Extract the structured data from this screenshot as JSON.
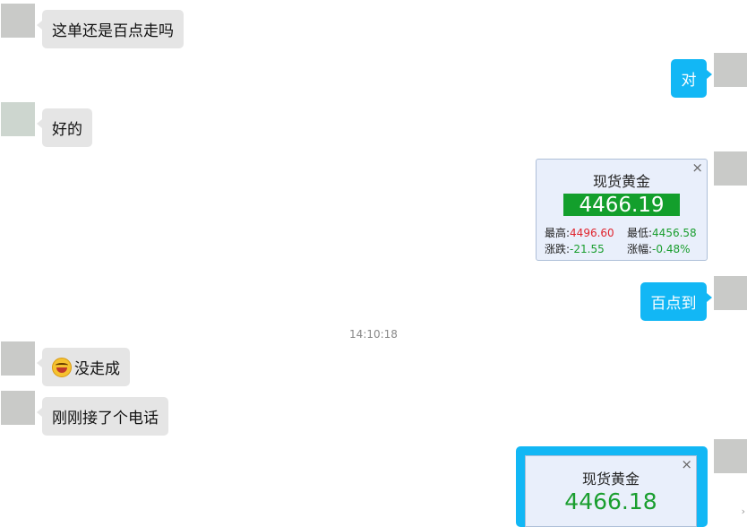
{
  "messages": {
    "m1": {
      "text": "这单还是百点走吗"
    },
    "m2": {
      "text": "对"
    },
    "m3": {
      "text": "好的"
    },
    "m5": {
      "text": "百点到"
    },
    "timestamp": "14:10:18",
    "m6": {
      "text": "没走成",
      "emoji_icon": "laughing-face-icon"
    },
    "m7": {
      "text": "刚刚接了个电话"
    }
  },
  "quote_card": {
    "title": "现货黄金",
    "price": "4466.19",
    "high_label": "最高:",
    "high_value": "4496.60",
    "low_label": "最低:",
    "low_value": "4456.58",
    "change_label": "涨跌:",
    "change_value": "-21.55",
    "pct_label": "涨幅:",
    "pct_value": "-0.48%",
    "close_symbol": "×"
  },
  "quote_card_2": {
    "title": "现货黄金",
    "price": "4466.18",
    "close_symbol": "×"
  },
  "colors": {
    "outgoing_bubble": "#12b7f5",
    "incoming_bubble": "#e5e5e5",
    "price_up_red": "#e0242d",
    "price_down_green": "#1a9e2f",
    "price_box": "#139f2c"
  },
  "scroll_hint": "›"
}
